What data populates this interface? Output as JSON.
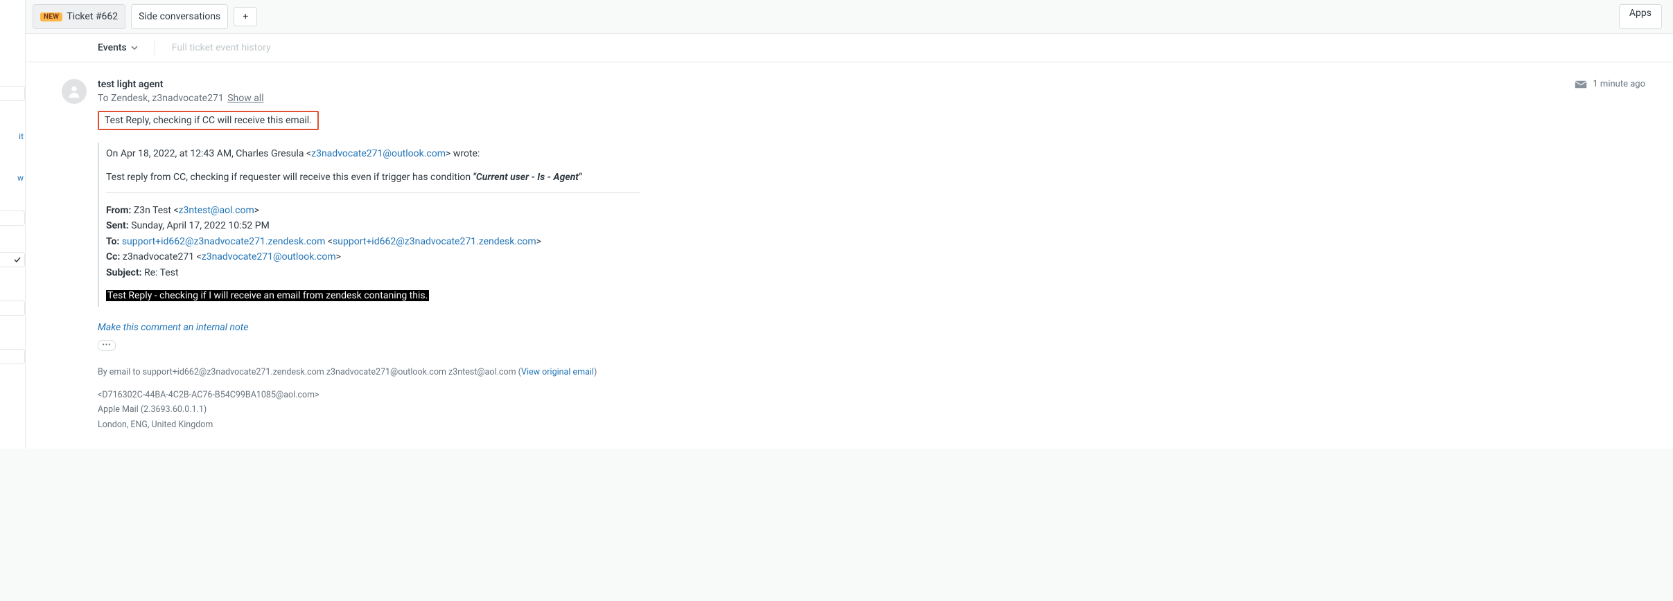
{
  "tabs": {
    "ticket": {
      "badge": "NEW",
      "label": "Ticket #662"
    },
    "side_convo": "Side conversations",
    "plus": "+"
  },
  "apps_label": "Apps",
  "subheader": {
    "events": "Events",
    "hint": "Full ticket event history"
  },
  "left_rail": {
    "link1": "it",
    "link2": "w"
  },
  "entry": {
    "sender": "test light agent",
    "recipients_prefix": "To",
    "recipients": "Zendesk, z3nadvocate271",
    "show_all": "Show all",
    "timestamp": "1 minute ago",
    "highlight": "Test Reply, checking if CC will receive this email.",
    "quote_intro_pre": "On Apr 18, 2022, at 12:43 AM, Charles Gresula <",
    "quote_intro_email": "z3nadvocate271@outlook.com",
    "quote_intro_post": "> wrote:",
    "cc_reply_text_pre": "Test reply from CC, checking if requester will receive this even if trigger has condition ",
    "cc_reply_cond": "\"Current user - Is - Agent\"",
    "hdr_from_label": "From:",
    "hdr_from_name": " Z3n Test <",
    "hdr_from_email": "z3ntest@aol.com",
    "hdr_from_close": ">",
    "hdr_sent_label": "Sent:",
    "hdr_sent_value": " Sunday, April 17, 2022 10:52 PM",
    "hdr_to_label": "To:",
    "hdr_to_email1": "support+id662@z3nadvocate271.zendesk.com",
    "hdr_to_mid": " <",
    "hdr_to_email2": "support+id662@z3nadvocate271.zendesk.com",
    "hdr_to_close": ">",
    "hdr_cc_label": "Cc:",
    "hdr_cc_name": " z3nadvocate271 <",
    "hdr_cc_email": "z3nadvocate271@outlook.com",
    "hdr_cc_close": ">",
    "hdr_subject_label": "Subject:",
    "hdr_subject_value": " Re: Test",
    "black_hl": "Test Reply - checking if I will receive an email from zendesk contaning this.",
    "internal_note": "Make this comment an internal note",
    "ellipsis": "•••",
    "meta_line1_pre": "By email to support+id662@z3nadvocate271.zendesk.com z3nadvocate271@outlook.com z3ntest@aol.com (",
    "meta_line1_link": "View original email",
    "meta_line1_post": ")",
    "meta_line2": "<D716302C-44BA-4C2B-AC76-B54C99BA1085@aol.com>",
    "meta_line3": "Apple Mail (2.3693.60.0.1.1)",
    "meta_line4": "London, ENG, United Kingdom"
  }
}
